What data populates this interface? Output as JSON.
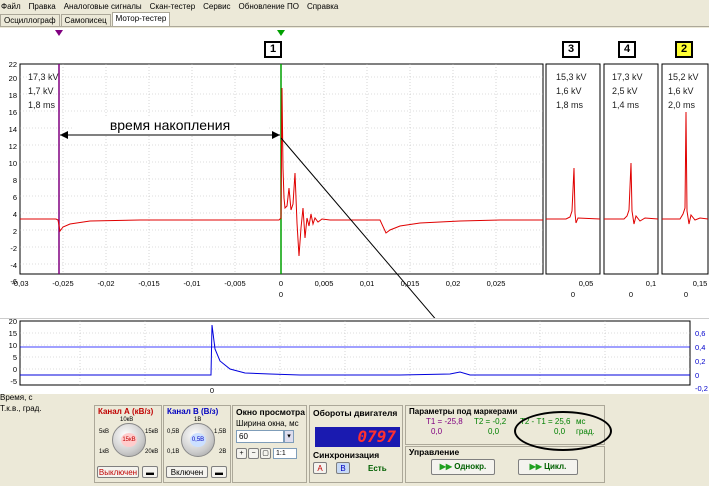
{
  "menu": [
    "Файл",
    "Правка",
    "Аналоговые сигналы",
    "Скан-тестер",
    "Сервис",
    "Обновление ПО",
    "Справка"
  ],
  "tabs": [
    "Осциллограф",
    "Самописец",
    "Мотор-тестер"
  ],
  "channels": [
    {
      "label": "1",
      "color": "#ffffff"
    },
    {
      "label": "3",
      "color": "#ffffff"
    },
    {
      "label": "4",
      "color": "#ffffff"
    },
    {
      "label": "2",
      "color": "#ffff33"
    }
  ],
  "panel_main": {
    "kv1": "17,3 kV",
    "kv2": "1,7 kV",
    "ms": "1,8 ms"
  },
  "panel3": {
    "kv1": "15,3 kV",
    "kv2": "1,6 kV",
    "ms": "1,8 ms"
  },
  "panel4": {
    "kv1": "17,3 kV",
    "kv2": "2,5 kV",
    "ms": "1,4 ms"
  },
  "panel2": {
    "kv1": "15,2 kV",
    "kv2": "1,6 kV",
    "ms": "2,0 ms"
  },
  "annotation": "время накопления",
  "upper_y_ticks": [
    "22",
    "20",
    "18",
    "16",
    "14",
    "12",
    "10",
    "8",
    "6",
    "4",
    "2",
    "0",
    "-2",
    "-4",
    "-6"
  ],
  "upper_x_ticks": [
    "-0,03",
    "-0,025",
    "-0,02",
    "-0,015",
    "-0,01",
    "-0,005",
    "0",
    "0,005",
    "0,01",
    "0,015",
    "0,02",
    "0,025"
  ],
  "x_zero_label": "0",
  "small_x_ticks": {
    "p3": [
      "0,05"
    ],
    "p4": [
      "0,1"
    ],
    "p2": [
      "0,15"
    ]
  },
  "small_zero": "0",
  "lower_left_ticks": [
    "20",
    "15",
    "10",
    "5",
    "0",
    "-5"
  ],
  "lower_right_ticks": [
    "0,6",
    "0,4",
    "0,2",
    "0",
    "-0,2"
  ],
  "lower_x_zero": "0",
  "footer_label1": "Время, с",
  "footer_label2": "Т.к.в., град.",
  "footer_x_zero": "0",
  "chanA": {
    "title": "Канал А (кВ/з)",
    "scale_top": "10кВ",
    "scale_left": "5кВ",
    "scale_right": "15кВ",
    "scale_bl": "1кВ",
    "scale_br": "20кВ",
    "knob": "15кВ",
    "off": "Выключен"
  },
  "chanB": {
    "title": "Канал В (В/з)",
    "scale_top": "1В",
    "scale_left": "0,5В",
    "scale_right": "1,5В",
    "scale_bl": "0,1В",
    "scale_br": "2В",
    "knob": "0,5В",
    "on": "Включен"
  },
  "window": {
    "title": "Окно просмотра",
    "width_label": "Ширина окна, мс",
    "width_value": "60",
    "ratio": "1:1"
  },
  "rpm": {
    "title": "Обороты двигателя",
    "value": "0797"
  },
  "sync": {
    "title": "Синхронизация",
    "a": "A",
    "b": "B",
    "status": "Есть"
  },
  "markers": {
    "title": "Параметры под маркерами",
    "t1": "Т1 = -25,8",
    "t2": "Т2 = -0,2",
    "t21": "Т2 - Т1 = 25,6",
    "unit_ms": "мс",
    "t1b": "0,0",
    "t2b": "0,0",
    "t21b": "0,0",
    "unit_deg": "град."
  },
  "control": {
    "title": "Управление",
    "single": "Однокр.",
    "cycle": "Цикл."
  }
}
